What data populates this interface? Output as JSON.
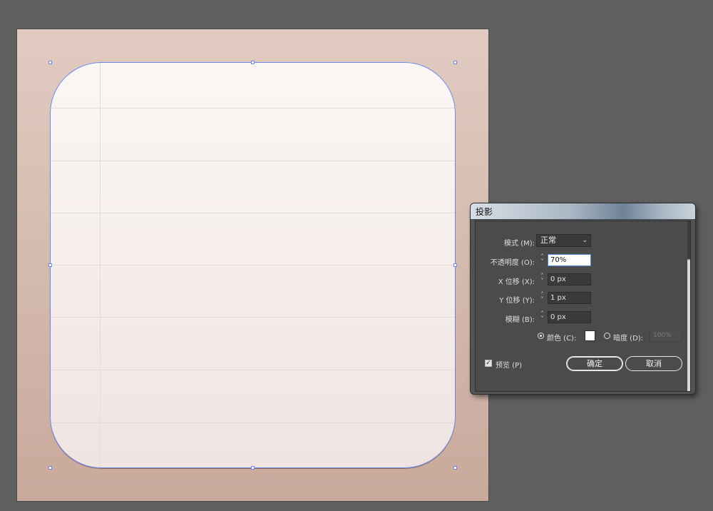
{
  "dialog": {
    "title": "投影",
    "mode_label": "模式 (M):",
    "mode_value": "正常",
    "opacity_label": "不透明度 (O):",
    "opacity_value": "70%",
    "x_offset_label": "X 位移 (X):",
    "x_offset_value": "0 px",
    "y_offset_label": "Y 位移 (Y):",
    "y_offset_value": "1 px",
    "blur_label": "模糊 (B):",
    "blur_value": "0 px",
    "color_label": "颜色 (C):",
    "color_value": "#ffffff",
    "color_selected": true,
    "darkness_label": "暗度 (D):",
    "darkness_value": "100%",
    "preview_label": "预览 (P)",
    "preview_checked": true,
    "ok_label": "确定",
    "cancel_label": "取消"
  },
  "colors": {
    "workspace": "#5f5f5f",
    "artboard_top": "#e1cbc1",
    "artboard_bottom": "#c8a99c",
    "selection": "#6f86e6"
  }
}
